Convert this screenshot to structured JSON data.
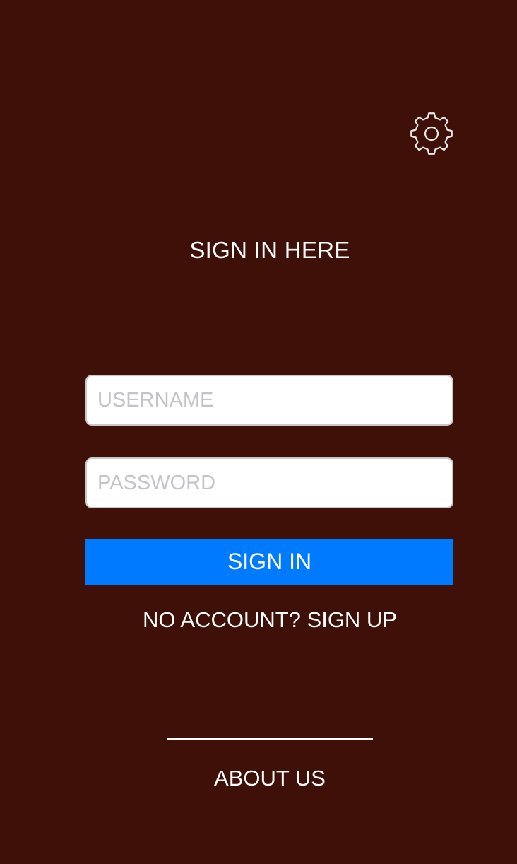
{
  "colors": {
    "background": "#3f1008",
    "primary_button": "#007aff",
    "text": "#ffffff"
  },
  "header": {
    "settings_icon": "gear-icon"
  },
  "main": {
    "title": "SIGN IN HERE",
    "username_placeholder": "USERNAME",
    "password_placeholder": "PASSWORD",
    "sign_in_label": "SIGN IN",
    "sign_up_link": "NO ACCOUNT? SIGN UP"
  },
  "footer": {
    "about_link": "ABOUT US"
  }
}
